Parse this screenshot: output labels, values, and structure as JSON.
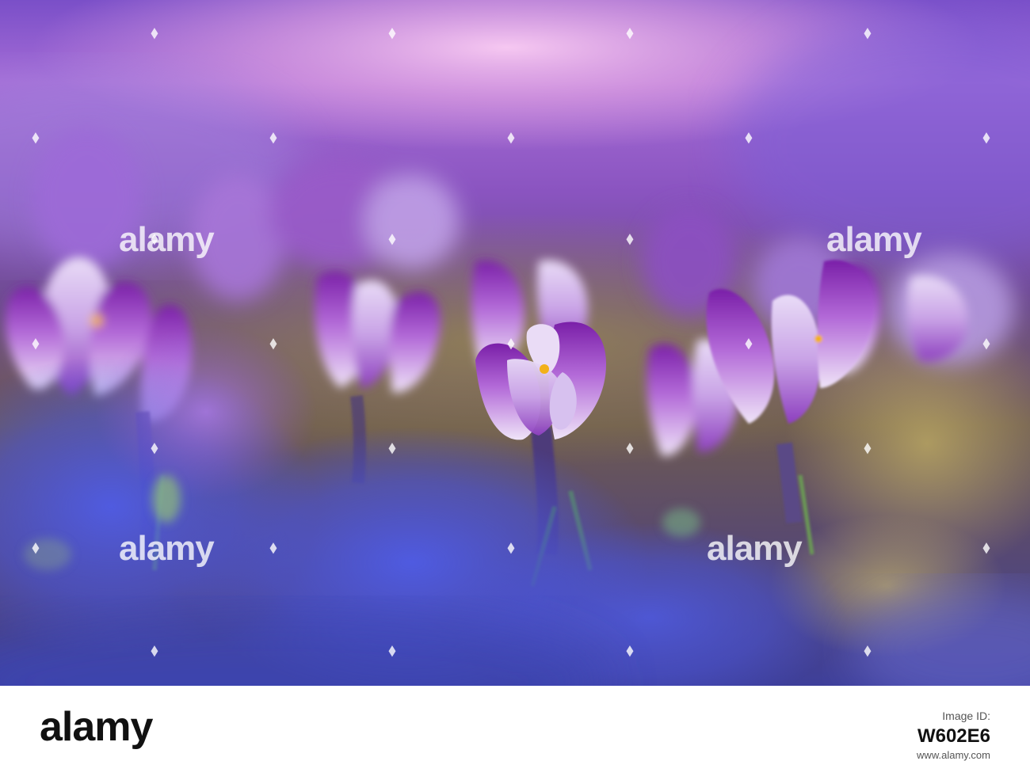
{
  "watermark": {
    "text": "alamy",
    "color": "#ffffff"
  },
  "footer": {
    "logo_text": "alamy",
    "stock_label": "Image ID:",
    "stock_id": "W602E6",
    "site": "www.alamy.com"
  },
  "scene": {
    "subject": "purple crocus flowers",
    "palette": {
      "top_glow": "#e7a7e3",
      "petal_purple": "#8a3cc4",
      "petal_light": "#e8d7f4",
      "stamen": "#f2b11a",
      "foreground_blue": "#4b55d8",
      "ground_olive": "#7a7238"
    }
  }
}
